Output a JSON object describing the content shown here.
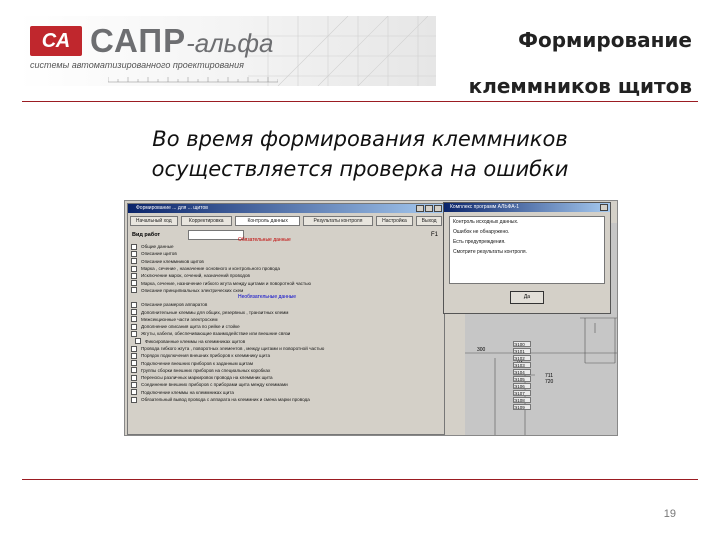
{
  "logo": {
    "mark": "СА",
    "name_main": "САПР",
    "name_suffix": "-альфа",
    "tagline": "системы автоматизированного проектирования",
    "ruler_ticks": "0      10      20      30      40      50      60      70      80      90      100      110      120      130      140      150      160"
  },
  "header": {
    "title_line1": "Формирование",
    "title_line2": "клеммников щитов"
  },
  "subtitle": {
    "line1": "Во время формирования клеммников",
    "line2": "осуществляется проверка на ошибки"
  },
  "page_number": "19",
  "colors": {
    "accent_red": "#c0272d",
    "rule_red": "#9b1c22",
    "logo_gray": "#6d6e71",
    "win_title": "#0a246a"
  },
  "screenshot": {
    "main_window": {
      "title": "Формирование ... для ... щитов",
      "tabs": [
        {
          "label": "Начальный ход",
          "active": false
        },
        {
          "label": "Корректировка",
          "active": false
        },
        {
          "label": "Контроль данных",
          "active": true
        },
        {
          "label": "Результаты контроля",
          "active": false
        },
        {
          "label": "Настройка",
          "active": false
        },
        {
          "label": "Выход",
          "active": false
        }
      ],
      "job_label": "Вид работ",
      "f1_label": "F1",
      "group_required": "Обязательные данные",
      "group_optional": "Необязательные данные",
      "required_items": [
        "Общие данные",
        "Описание щитов",
        "Описание клеммников щитов",
        "Марка , сечение , назначение основного и контрольного провода",
        "Исключение марок, сечений, назначений проводов",
        "Марка, сечение, назначение гибкого жгута между щитами и поворотной частью",
        "Описание принципиальных электрических схем"
      ],
      "optional_items": [
        {
          "text": "Описание размеров аппаратов",
          "indent": false
        },
        {
          "text": "Дополнительные клеммы для общих, резервных , транзитных клемм",
          "indent": false
        },
        {
          "text": "Межсекционные части электросхем",
          "indent": false
        },
        {
          "text": "Дополнение описания щита по рейке и стойке",
          "indent": false
        },
        {
          "text": "Жгуты, кабели, обеспечивающие взаимодействие или внешние связи",
          "indent": false
        },
        {
          "text": "Фиксированные клеммы на клеммниках щитов",
          "indent": true
        },
        {
          "text": "Провода гибкого жгута , поворотных элементов , между щитами и поворотной частью",
          "indent": false
        },
        {
          "text": "Порядок подключения внешних приборов к клеммнику щита",
          "indent": false
        },
        {
          "text": "Подключение внешних приборов к заданным щитам",
          "indent": false
        },
        {
          "text": "Группы сборки внешних приборов на специальных коробках",
          "indent": false
        },
        {
          "text": "Переносы различных маркировок провода на клеммник щита",
          "indent": false
        },
        {
          "text": "Соединение внешних приборов с приборами щита между клеммами",
          "indent": false
        },
        {
          "text": "Подключение клеммы на клеммниках щита",
          "indent": false
        },
        {
          "text": "Обязательный вывод провода с аппарата на клеммник и смена марки провода",
          "indent": false
        }
      ]
    },
    "message_box": {
      "title": "Комплекс программ АЛЬФА-1",
      "lines": [
        "Контроль исходных данных.",
        "Ошибок не обнаружено.",
        "Есть предупреждения.",
        "Смотрите результаты контроля."
      ],
      "ok_label": "Да"
    },
    "drawing_labels": {
      "a": "300",
      "b": "X1",
      "c": "711",
      "d": "720",
      "terminals": [
        "Э100",
        "Э101",
        "Э102",
        "Э103",
        "Э104",
        "Э105",
        "Э106",
        "Э107",
        "Э108",
        "Э109"
      ]
    }
  }
}
